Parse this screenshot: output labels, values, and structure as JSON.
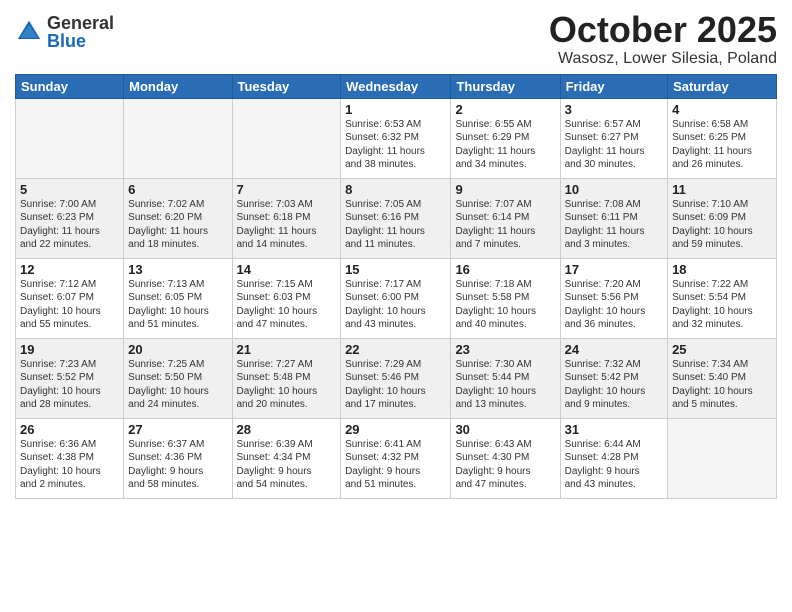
{
  "header": {
    "logo_general": "General",
    "logo_blue": "Blue",
    "month_title": "October 2025",
    "location": "Wasosz, Lower Silesia, Poland"
  },
  "weekdays": [
    "Sunday",
    "Monday",
    "Tuesday",
    "Wednesday",
    "Thursday",
    "Friday",
    "Saturday"
  ],
  "weeks": [
    [
      {
        "day": "",
        "info": ""
      },
      {
        "day": "",
        "info": ""
      },
      {
        "day": "",
        "info": ""
      },
      {
        "day": "1",
        "info": "Sunrise: 6:53 AM\nSunset: 6:32 PM\nDaylight: 11 hours\nand 38 minutes."
      },
      {
        "day": "2",
        "info": "Sunrise: 6:55 AM\nSunset: 6:29 PM\nDaylight: 11 hours\nand 34 minutes."
      },
      {
        "day": "3",
        "info": "Sunrise: 6:57 AM\nSunset: 6:27 PM\nDaylight: 11 hours\nand 30 minutes."
      },
      {
        "day": "4",
        "info": "Sunrise: 6:58 AM\nSunset: 6:25 PM\nDaylight: 11 hours\nand 26 minutes."
      }
    ],
    [
      {
        "day": "5",
        "info": "Sunrise: 7:00 AM\nSunset: 6:23 PM\nDaylight: 11 hours\nand 22 minutes."
      },
      {
        "day": "6",
        "info": "Sunrise: 7:02 AM\nSunset: 6:20 PM\nDaylight: 11 hours\nand 18 minutes."
      },
      {
        "day": "7",
        "info": "Sunrise: 7:03 AM\nSunset: 6:18 PM\nDaylight: 11 hours\nand 14 minutes."
      },
      {
        "day": "8",
        "info": "Sunrise: 7:05 AM\nSunset: 6:16 PM\nDaylight: 11 hours\nand 11 minutes."
      },
      {
        "day": "9",
        "info": "Sunrise: 7:07 AM\nSunset: 6:14 PM\nDaylight: 11 hours\nand 7 minutes."
      },
      {
        "day": "10",
        "info": "Sunrise: 7:08 AM\nSunset: 6:11 PM\nDaylight: 11 hours\nand 3 minutes."
      },
      {
        "day": "11",
        "info": "Sunrise: 7:10 AM\nSunset: 6:09 PM\nDaylight: 10 hours\nand 59 minutes."
      }
    ],
    [
      {
        "day": "12",
        "info": "Sunrise: 7:12 AM\nSunset: 6:07 PM\nDaylight: 10 hours\nand 55 minutes."
      },
      {
        "day": "13",
        "info": "Sunrise: 7:13 AM\nSunset: 6:05 PM\nDaylight: 10 hours\nand 51 minutes."
      },
      {
        "day": "14",
        "info": "Sunrise: 7:15 AM\nSunset: 6:03 PM\nDaylight: 10 hours\nand 47 minutes."
      },
      {
        "day": "15",
        "info": "Sunrise: 7:17 AM\nSunset: 6:00 PM\nDaylight: 10 hours\nand 43 minutes."
      },
      {
        "day": "16",
        "info": "Sunrise: 7:18 AM\nSunset: 5:58 PM\nDaylight: 10 hours\nand 40 minutes."
      },
      {
        "day": "17",
        "info": "Sunrise: 7:20 AM\nSunset: 5:56 PM\nDaylight: 10 hours\nand 36 minutes."
      },
      {
        "day": "18",
        "info": "Sunrise: 7:22 AM\nSunset: 5:54 PM\nDaylight: 10 hours\nand 32 minutes."
      }
    ],
    [
      {
        "day": "19",
        "info": "Sunrise: 7:23 AM\nSunset: 5:52 PM\nDaylight: 10 hours\nand 28 minutes."
      },
      {
        "day": "20",
        "info": "Sunrise: 7:25 AM\nSunset: 5:50 PM\nDaylight: 10 hours\nand 24 minutes."
      },
      {
        "day": "21",
        "info": "Sunrise: 7:27 AM\nSunset: 5:48 PM\nDaylight: 10 hours\nand 20 minutes."
      },
      {
        "day": "22",
        "info": "Sunrise: 7:29 AM\nSunset: 5:46 PM\nDaylight: 10 hours\nand 17 minutes."
      },
      {
        "day": "23",
        "info": "Sunrise: 7:30 AM\nSunset: 5:44 PM\nDaylight: 10 hours\nand 13 minutes."
      },
      {
        "day": "24",
        "info": "Sunrise: 7:32 AM\nSunset: 5:42 PM\nDaylight: 10 hours\nand 9 minutes."
      },
      {
        "day": "25",
        "info": "Sunrise: 7:34 AM\nSunset: 5:40 PM\nDaylight: 10 hours\nand 5 minutes."
      }
    ],
    [
      {
        "day": "26",
        "info": "Sunrise: 6:36 AM\nSunset: 4:38 PM\nDaylight: 10 hours\nand 2 minutes."
      },
      {
        "day": "27",
        "info": "Sunrise: 6:37 AM\nSunset: 4:36 PM\nDaylight: 9 hours\nand 58 minutes."
      },
      {
        "day": "28",
        "info": "Sunrise: 6:39 AM\nSunset: 4:34 PM\nDaylight: 9 hours\nand 54 minutes."
      },
      {
        "day": "29",
        "info": "Sunrise: 6:41 AM\nSunset: 4:32 PM\nDaylight: 9 hours\nand 51 minutes."
      },
      {
        "day": "30",
        "info": "Sunrise: 6:43 AM\nSunset: 4:30 PM\nDaylight: 9 hours\nand 47 minutes."
      },
      {
        "day": "31",
        "info": "Sunrise: 6:44 AM\nSunset: 4:28 PM\nDaylight: 9 hours\nand 43 minutes."
      },
      {
        "day": "",
        "info": ""
      }
    ]
  ]
}
